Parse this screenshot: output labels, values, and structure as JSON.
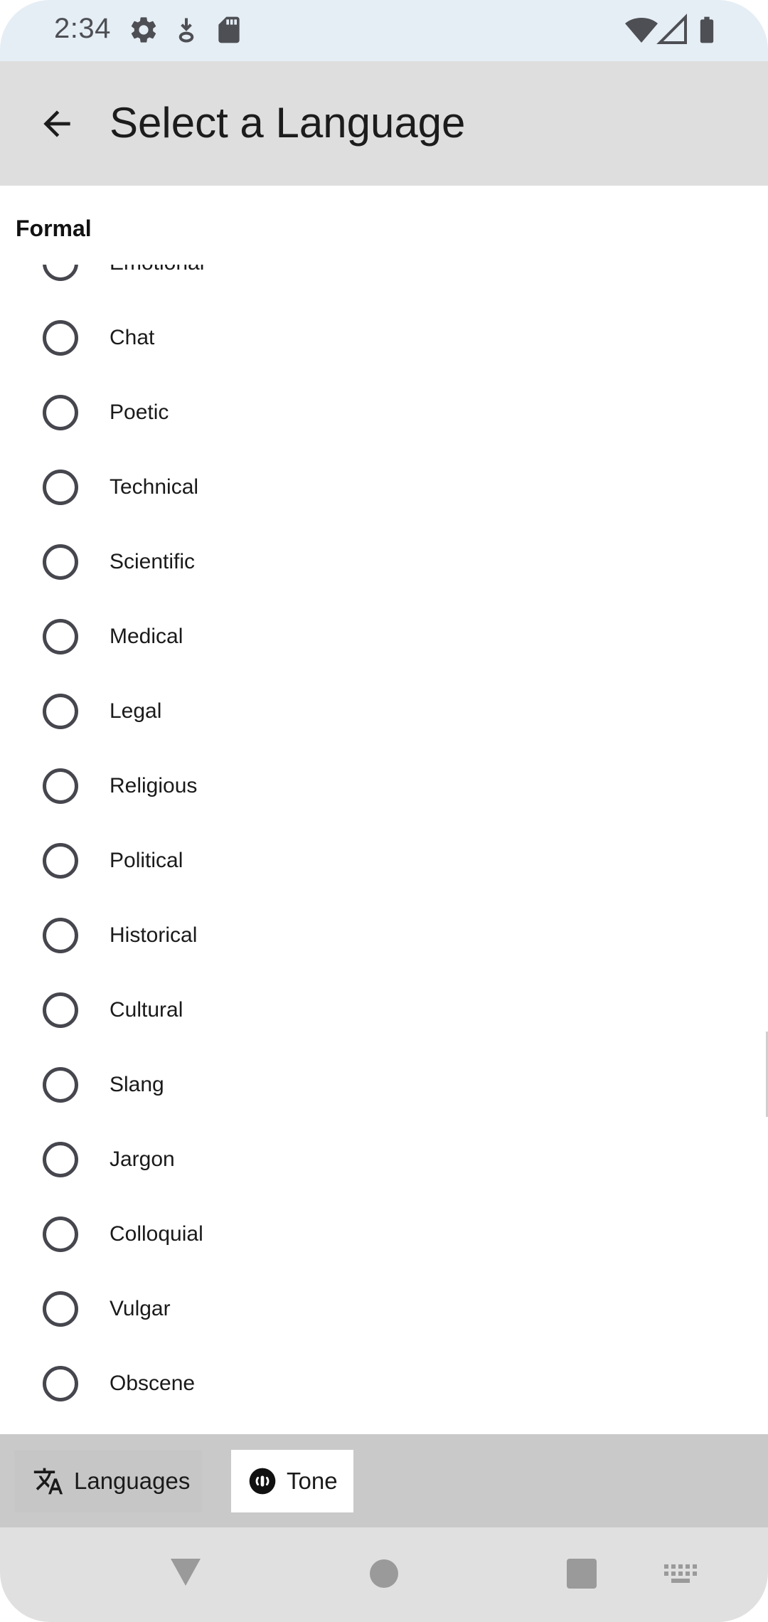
{
  "status_bar": {
    "time": "2:34",
    "left_icons": [
      "gear-icon",
      "download-arrow-icon",
      "sd-card-icon"
    ],
    "right_icons": [
      "wifi-icon",
      "cell-signal-icon",
      "battery-icon"
    ]
  },
  "app_bar": {
    "title": "Select a Language",
    "back_icon": "arrow-back-icon"
  },
  "section": {
    "header": "Formal"
  },
  "options": [
    {
      "label": "Emotional",
      "selected": false
    },
    {
      "label": "Chat",
      "selected": false
    },
    {
      "label": "Poetic",
      "selected": false
    },
    {
      "label": "Technical",
      "selected": false
    },
    {
      "label": "Scientific",
      "selected": false
    },
    {
      "label": "Medical",
      "selected": false
    },
    {
      "label": "Legal",
      "selected": false
    },
    {
      "label": "Religious",
      "selected": false
    },
    {
      "label": "Political",
      "selected": false
    },
    {
      "label": "Historical",
      "selected": false
    },
    {
      "label": "Cultural",
      "selected": false
    },
    {
      "label": "Slang",
      "selected": false
    },
    {
      "label": "Jargon",
      "selected": false
    },
    {
      "label": "Colloquial",
      "selected": false
    },
    {
      "label": "Vulgar",
      "selected": false
    },
    {
      "label": "Obscene",
      "selected": false
    }
  ],
  "bottom_tabs": [
    {
      "label": "Languages",
      "icon": "translate-icon",
      "active": false
    },
    {
      "label": "Tone",
      "icon": "tone-icon",
      "active": true
    }
  ],
  "nav_bar": {
    "icons": [
      "back-triangle-icon",
      "home-circle-icon",
      "recents-square-icon",
      "keyboard-icon"
    ]
  },
  "colors": {
    "status_bar_bg": "#e6eef5",
    "app_bar_bg": "#dedede",
    "tab_bar_bg": "#c9c9c9",
    "active_tab_bg": "#ffffff",
    "radio_outline": "#46464e"
  }
}
